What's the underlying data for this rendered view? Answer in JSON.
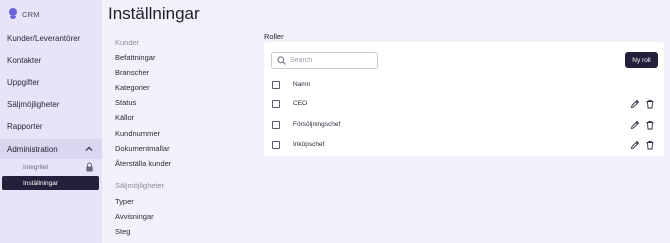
{
  "app": {
    "logo_text": "CRM"
  },
  "sidebar": {
    "items": [
      {
        "label": "Kunder/Leverantörer"
      },
      {
        "label": "Kontakter"
      },
      {
        "label": "Uppgifter"
      },
      {
        "label": "Säljmöjligheter"
      },
      {
        "label": "Rapporter"
      }
    ],
    "admin": {
      "label": "Administration",
      "subitems": [
        {
          "label": "Integritet",
          "locked": true
        },
        {
          "label": "Inställningar",
          "active": true
        }
      ]
    }
  },
  "page": {
    "title": "Inställningar"
  },
  "settings_menu": {
    "kunder": {
      "heading": "Kunder",
      "links": [
        "Befattningar",
        "Branscher",
        "Kategorier",
        "Status",
        "Källor",
        "Kundnummer",
        "Dokumentmallar",
        "Återställa kunder"
      ]
    },
    "saljmojligheter": {
      "heading": "Säljmöjligheter",
      "links": [
        "Typer",
        "Avvisningar",
        "Steg"
      ]
    }
  },
  "roles": {
    "label": "Roller",
    "search": {
      "placeholder": "Search",
      "value": ""
    },
    "new_button": "Ny roll",
    "column_header": "Namn",
    "rows": [
      {
        "name": "CEO"
      },
      {
        "name": "Försöljningschef"
      },
      {
        "name": "Inköpschef"
      }
    ]
  },
  "colors": {
    "accent": "#6b62d9",
    "dark": "#23203c",
    "sidebar": "#e6e4f6",
    "background": "#f2f1fa"
  }
}
